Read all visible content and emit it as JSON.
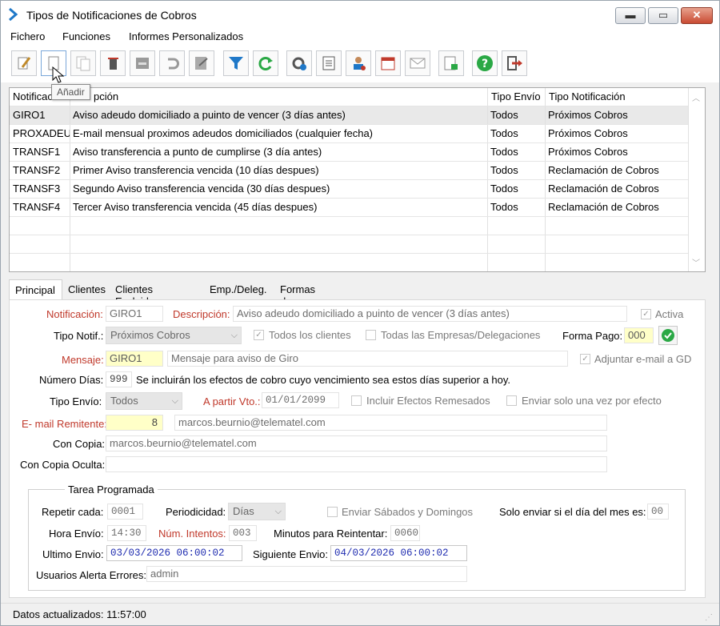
{
  "window": {
    "title": "Tipos de Notificaciones de Cobros",
    "min_label": "▬",
    "max_label": "▭",
    "close_label": "✕"
  },
  "menu": [
    "Fichero",
    "Funciones",
    "Informes Personalizados"
  ],
  "toolbar": {
    "buttons": [
      "edit-icon",
      "add-icon",
      "copy-icon",
      "delete-icon",
      "save-icon",
      "undo-icon",
      "print-preview-icon",
      "filter-icon",
      "refresh-icon",
      "settings-icon",
      "document-icon",
      "user-icon",
      "calendar-icon",
      "email-icon",
      "export-icon",
      "help-icon",
      "exit-icon"
    ],
    "tooltip": "Añadir"
  },
  "grid": {
    "headers": [
      "Notificación",
      "Descripción",
      "Tipo Envío",
      "Tipo Notificación"
    ],
    "header_visible": [
      "Notificac",
      "pción",
      "Tipo Envío",
      "Tipo Notificación"
    ],
    "rows": [
      [
        "GIRO1",
        "Aviso adeudo domiciliado a puinto de vencer (3 días antes)",
        "Todos",
        "Próximos Cobros"
      ],
      [
        "PROXADEU",
        "E-mail mensual proximos adeudos domiciliados (cualquier fecha)",
        "Todos",
        "Próximos Cobros"
      ],
      [
        "TRANSF1",
        "Aviso transferencia a punto de cumplirse (3 día antes)",
        "Todos",
        "Próximos Cobros"
      ],
      [
        "TRANSF2",
        "Primer Aviso transferencia vencida  (10 días despues)",
        "Todos",
        "Reclamación de Cobros"
      ],
      [
        "TRANSF3",
        "Segundo Aviso transferencia vencida  (30 días despues)",
        "Todos",
        "Reclamación de Cobros"
      ],
      [
        "TRANSF4",
        "Tercer Aviso transferencia vencida  (45 días despues)",
        "Todos",
        "Reclamación de Cobros"
      ]
    ]
  },
  "tabs": [
    "Principal",
    "Clientes",
    "Clientes Excluidos",
    "Emp./Deleg.",
    "Formas de Pago"
  ],
  "form": {
    "notificacion_label": "Notificación:",
    "notificacion": "GIRO1",
    "descripcion_label": "Descripción:",
    "descripcion": "Aviso adeudo domiciliado a puinto de vencer (3 días antes)",
    "activa_label": "Activa",
    "tipo_notif_label": "Tipo Notif.:",
    "tipo_notif": "Próximos Cobros",
    "todos_clientes_label": "Todos los clientes",
    "todas_empresas_label": "Todas las Empresas/Delegaciones",
    "forma_pago_label": "Forma Pago:",
    "forma_pago": "000",
    "mensaje_label": "Mensaje:",
    "mensaje_code": "GIRO1",
    "mensaje_desc": "Mensaje para aviso de Giro",
    "adjuntar_label": "Adjuntar e-mail a GD",
    "numero_dias_label": "Número Días:",
    "numero_dias": "999",
    "numero_dias_hint": "Se incluirán los efectos de cobro cuyo vencimiento sea estos días superior a hoy.",
    "tipo_envio_label": "Tipo Envío:",
    "tipo_envio": "Todos",
    "a_partir_label": "A partir Vto.:",
    "a_partir": "01/01/2099",
    "incluir_label": "Incluir Efectos Remesados",
    "enviar_una_vez_label": "Enviar solo una vez por efecto",
    "email_remitente_label": "E- mail Remitente:",
    "email_remitente_code": "8",
    "email_remitente": "marcos.beurnio@telematel.com",
    "con_copia_label": "Con Copia:",
    "con_copia": "marcos.beurnio@telematel.com",
    "con_copia_oculta_label": "Con Copia Oculta:",
    "con_copia_oculta": ""
  },
  "tarea": {
    "title": "Tarea Programada",
    "repetir_label": "Repetir cada:",
    "repetir": "0001",
    "periodicidad_label": "Periodicidad:",
    "periodicidad": "Días",
    "sabados_label": "Enviar Sábados y Domingos",
    "solo_dia_label": "Solo enviar si el día del mes es:",
    "solo_dia": "00",
    "hora_label": "Hora Envío:",
    "hora": "14:30",
    "intentos_label": "Núm. Intentos:",
    "intentos": "003",
    "minutos_label": "Minutos para Reintentar:",
    "minutos": "0060",
    "ultimo_label": "Ultimo Envio:",
    "ultimo": "03/03/2026 06:00:02",
    "siguiente_label": "Siguiente Envio:",
    "siguiente": "04/03/2026 06:00:02",
    "usuarios_label": "Usuarios Alerta Errores:",
    "usuarios": "admin"
  },
  "status": {
    "text": "Datos actualizados: 11:57:00"
  },
  "colors": {
    "accent": "#1f78c8",
    "label_red": "#c0392b",
    "highlight_yellow": "#ffffc8",
    "date_blue": "#1f2cb0"
  }
}
